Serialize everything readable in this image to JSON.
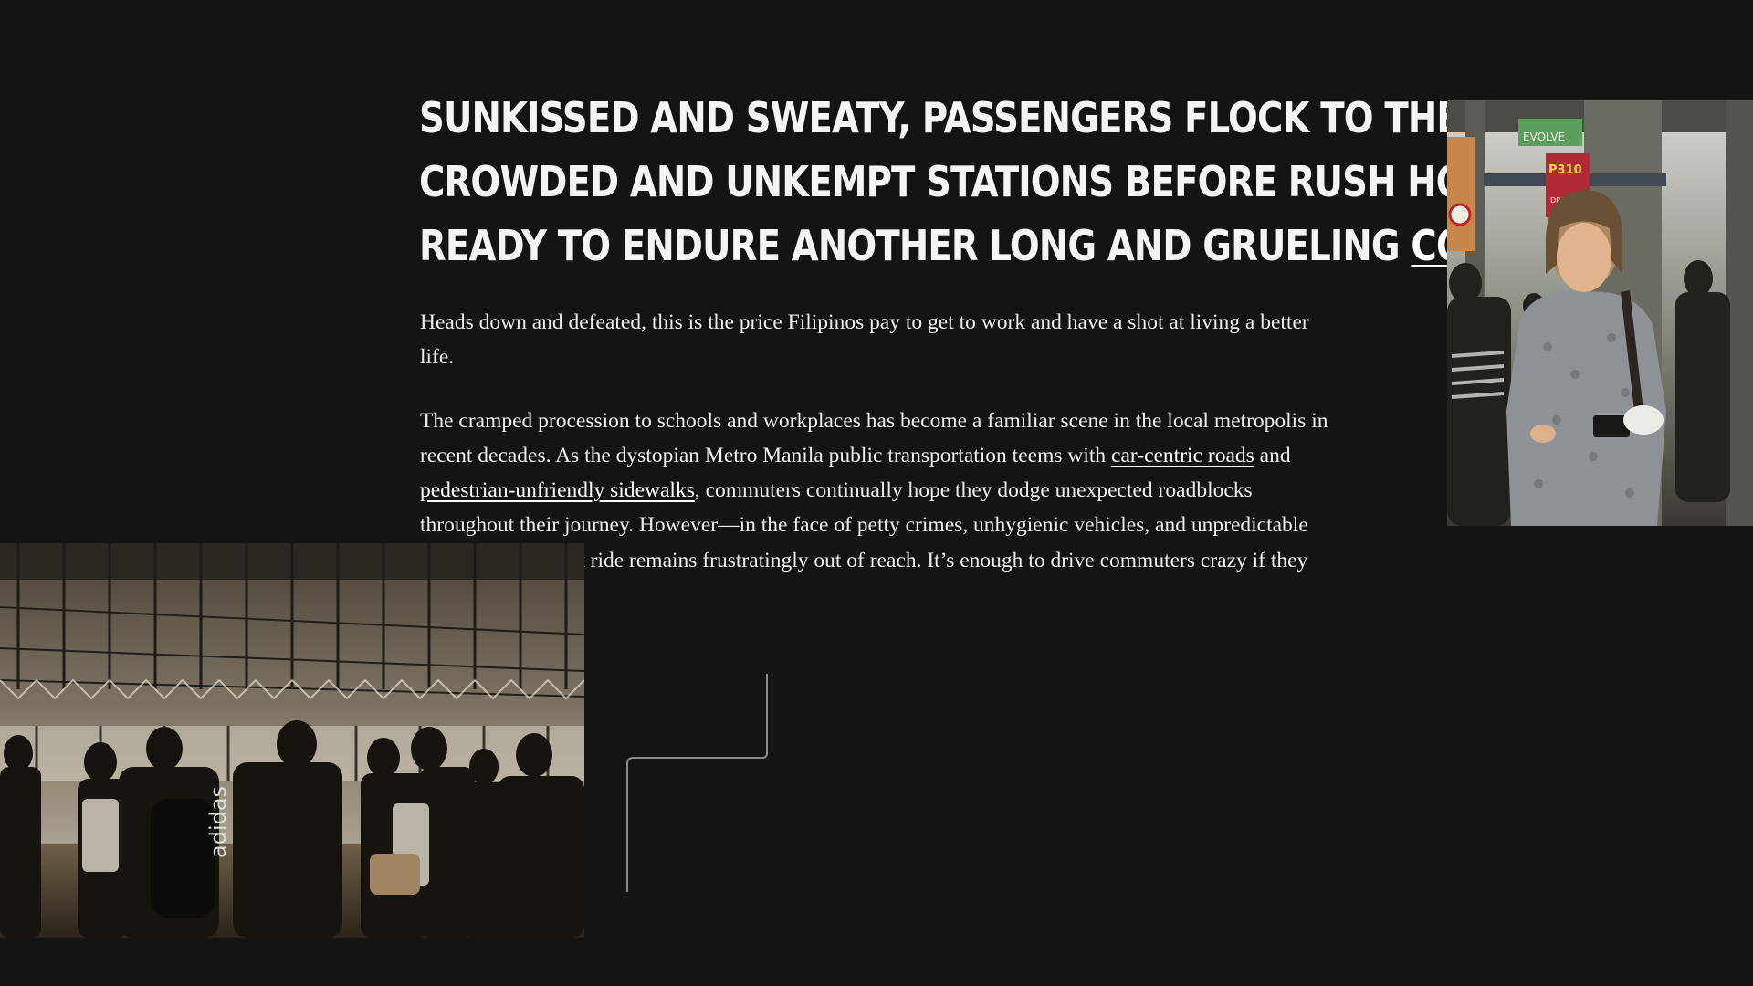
{
  "headline": {
    "line1": "SUNKISSED AND SWEATY, PASSENGERS FLOCK TO THE",
    "line2": "CROWDED AND UNKEMPT STATIONS BEFORE RUSH HOUR,",
    "line3_prefix": "READY TO ENDURE ANOTHER LONG AND GRUELING ",
    "link": "COMMUTE",
    "suffix": "."
  },
  "paragraph1": "Heads down and defeated, this is the price Filipinos pay to get to work and have a shot at living a better life.",
  "paragraph2": {
    "text_a": "The cramped procession to schools and workplaces has become a familiar scene in the local metropolis in recent decades. As the dystopian Metro Manila public transportation teems with ",
    "link_car": "car-centric roads",
    "text_and": " and ",
    "link_ped": "pedestrian-unfriendly sidewalks",
    "text_b": ", commuters continually hope they dodge unexpected roadblocks throughout their journey. However—in the face of petty crimes, unhygienic vehicles, and unpredictable flooding—a decent ride remains frustratingly out of reach. It’s enough to drive commuters crazy if they let it."
  },
  "photo_platform": {
    "bag_brand": "adidas"
  },
  "photo_commuter": {
    "sign_evolve": "EVOLVE",
    "sign_price": "P310",
    "sign_drive": "DRIVE"
  },
  "colors": {
    "background": "#141414",
    "text": "#f0f0f0",
    "connector": "#8a8a8a"
  }
}
